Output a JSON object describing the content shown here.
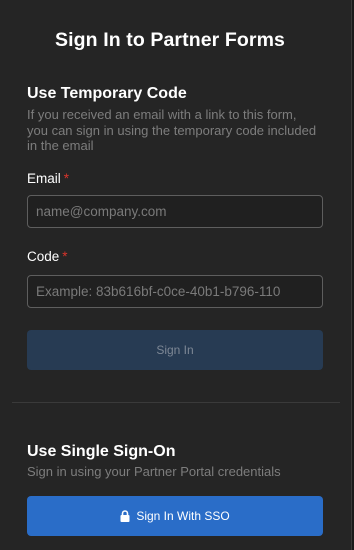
{
  "page": {
    "title": "Sign In to Partner Forms"
  },
  "temporary_code": {
    "heading": "Use Temporary Code",
    "description": "If you received an email with a link to this form, you can sign in using the temporary code included in the email",
    "email": {
      "label": "Email",
      "required_mark": "*",
      "value": "",
      "placeholder": "name@company.com"
    },
    "code": {
      "label": "Code",
      "required_mark": "*",
      "value": "",
      "placeholder": "Example: 83b616bf-c0ce-40b1-b796-110"
    },
    "submit_label": "Sign In"
  },
  "sso": {
    "heading": "Use Single Sign-On",
    "description": "Sign in using your Partner Portal credentials",
    "button_label": "Sign In With SSO",
    "button_icon": "lock-icon"
  },
  "colors": {
    "background": "#252525",
    "required": "#d9342b",
    "sso_button": "#2a6dc8",
    "disabled_button": "#273b53"
  }
}
